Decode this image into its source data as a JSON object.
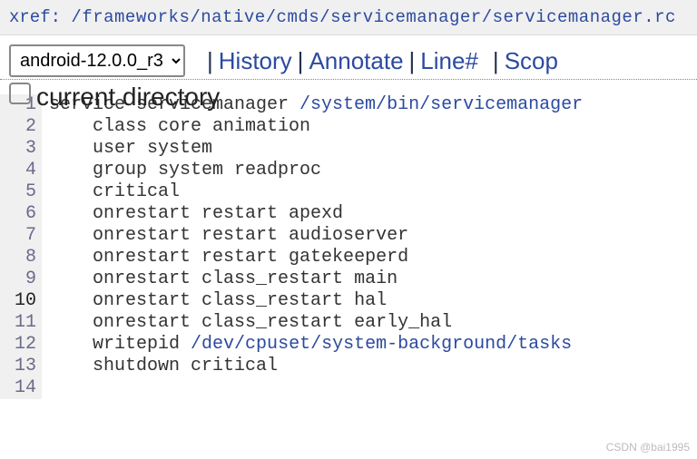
{
  "xref": {
    "label": "xref: ",
    "path": "/frameworks/native/cmds/servicemanager/servicemanager.rc"
  },
  "toolbar": {
    "branch": "android-12.0.0_r3",
    "sep": "|",
    "history": "History",
    "annotate": "Annotate",
    "lineno": "Line#",
    "scopes": "Scop"
  },
  "curdir": {
    "label": "current directory"
  },
  "code": {
    "lines": [
      {
        "n": "1",
        "indent": "",
        "text": "service servicemanager ",
        "link": "/system/bin/servicemanager"
      },
      {
        "n": "2",
        "indent": "    ",
        "text": "class core animation"
      },
      {
        "n": "3",
        "indent": "    ",
        "text": "user system"
      },
      {
        "n": "4",
        "indent": "    ",
        "text": "group system readproc"
      },
      {
        "n": "5",
        "indent": "    ",
        "text": "critical"
      },
      {
        "n": "6",
        "indent": "    ",
        "text": "onrestart restart apexd"
      },
      {
        "n": "7",
        "indent": "    ",
        "text": "onrestart restart audioserver"
      },
      {
        "n": "8",
        "indent": "    ",
        "text": "onrestart restart gatekeeperd"
      },
      {
        "n": "9",
        "indent": "    ",
        "text": "onrestart class_restart main"
      },
      {
        "n": "10",
        "indent": "    ",
        "text": "onrestart class_restart hal"
      },
      {
        "n": "11",
        "indent": "    ",
        "text": "onrestart class_restart early_hal"
      },
      {
        "n": "12",
        "indent": "    ",
        "text": "writepid ",
        "link": "/dev/cpuset/system-background/tasks"
      },
      {
        "n": "13",
        "indent": "    ",
        "text": "shutdown critical"
      },
      {
        "n": "14",
        "indent": "",
        "text": ""
      }
    ]
  },
  "watermark": "CSDN @bai1995"
}
